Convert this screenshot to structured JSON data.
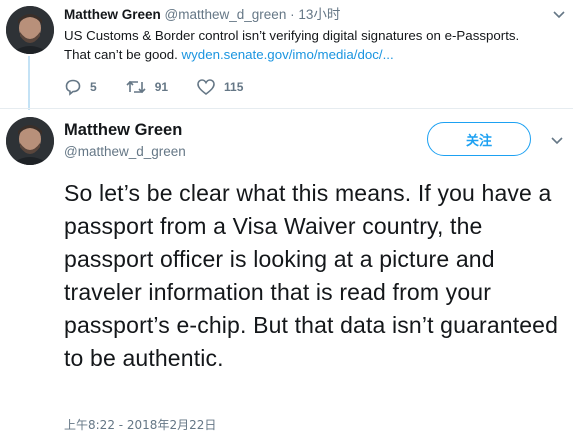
{
  "tweet1": {
    "author_name": "Matthew Green",
    "handle": "@matthew_d_green",
    "separator": "·",
    "time": "13小时",
    "text": "US Customs & Border control isn’t verifying digital signatures on e-Passports. That can’t be good.",
    "link_text": "wyden.senate.gov/imo/media/doc/...",
    "replies": "5",
    "retweets": "91",
    "likes": "115"
  },
  "tweet2": {
    "author_name": "Matthew Green",
    "handle": "@matthew_d_green",
    "follow_label": "关注",
    "text": "So let’s be clear what this means. If you have a passport from a Visa Waiver country, the passport officer is looking at a picture and traveler information that is read from your passport’s e-chip. But that data isn’t guaranteed to be authentic.",
    "timestamp": "上午8:22 - 2018年2月22日"
  },
  "colors": {
    "accent": "#1da1f2",
    "link": "#1b95e0",
    "muted": "#657786",
    "text": "#14171a",
    "thread_line": "#c4e2f5"
  },
  "icons": [
    "reply-icon",
    "retweet-icon",
    "like-icon",
    "chevron-down-icon"
  ]
}
